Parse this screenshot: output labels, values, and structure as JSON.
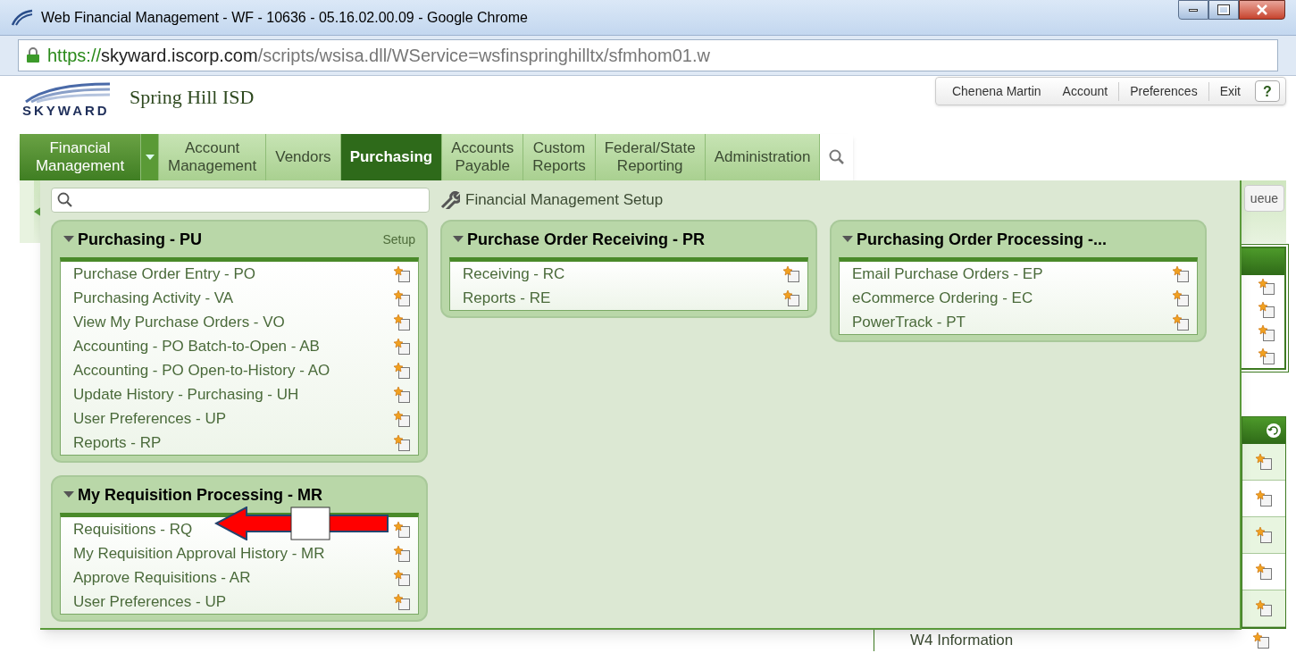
{
  "window": {
    "title": "Web Financial Management - WF - 10636 - 05.16.02.00.09 - Google Chrome"
  },
  "address": {
    "scheme": "https://",
    "host": "skyward.iscorp.com",
    "path": "/scripts/wsisa.dll/WService=wsfinspringhilltx/sfmhom01.w"
  },
  "header": {
    "logo_text": "SKYWARD",
    "district": "Spring Hill ISD",
    "user_menu": [
      "Chenena Martin",
      "Account",
      "Preferences",
      "Exit"
    ],
    "help": "?"
  },
  "nav": [
    {
      "label": "Financial Management",
      "kind": "module",
      "selected": false
    },
    {
      "label": "Account Management",
      "kind": "tab",
      "selected": false
    },
    {
      "label": "Vendors",
      "kind": "tab",
      "selected": false
    },
    {
      "label": "Purchasing",
      "kind": "tab",
      "selected": true
    },
    {
      "label": "Accounts Payable",
      "kind": "tab",
      "selected": false
    },
    {
      "label": "Custom Reports",
      "kind": "tab",
      "selected": false
    },
    {
      "label": "Federal/State Reporting",
      "kind": "tab",
      "selected": false
    },
    {
      "label": "Administration",
      "kind": "tab",
      "selected": false
    }
  ],
  "menu": {
    "setup_link": "Financial Management Setup",
    "columns": [
      [
        {
          "title": "Purchasing - PU",
          "setup": "Setup",
          "items": [
            "Purchase Order Entry - PO",
            "Purchasing Activity - VA",
            "View My Purchase Orders - VO",
            "Accounting - PO Batch-to-Open - AB",
            "Accounting - PO Open-to-History - AO",
            "Update History - Purchasing - UH",
            "User Preferences - UP",
            "Reports - RP"
          ]
        },
        {
          "title": "My Requisition Processing - MR",
          "items": [
            "Requisitions - RQ",
            "My Requisition Approval History - MR",
            "Approve Requisitions - AR",
            "User Preferences - UP"
          ]
        }
      ],
      [
        {
          "title": "Purchase Order Receiving - PR",
          "items": [
            "Receiving - RC",
            "Reports - RE"
          ]
        }
      ],
      [
        {
          "title": "Purchasing Order Processing -...",
          "items": [
            "Email Purchase Orders - EP",
            "eCommerce Ordering - EC",
            "PowerTrack - PT"
          ]
        }
      ]
    ]
  },
  "background": {
    "queue_button": "ueue",
    "list_item": "W4 Information"
  }
}
